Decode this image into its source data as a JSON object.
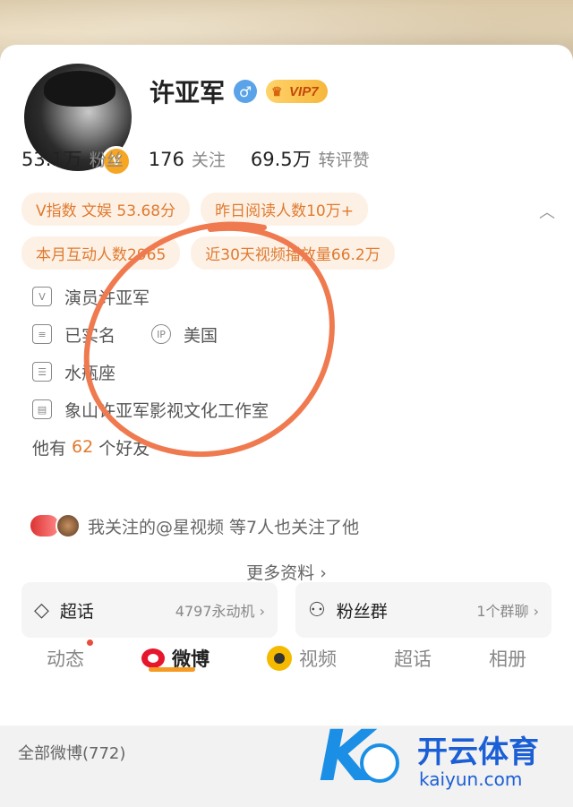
{
  "profile": {
    "name": "许亚军",
    "gender_symbol": "♂",
    "vip_label": "VIP7",
    "verified_badge": "V"
  },
  "stats": [
    {
      "value": "53.1万",
      "label": "粉丝"
    },
    {
      "value": "176",
      "label": "关注"
    },
    {
      "value": "69.5万",
      "label": "转评赞"
    }
  ],
  "tags": {
    "row1": [
      "V指数 文娱 53.68分",
      "昨日阅读人数10万+"
    ],
    "row2": [
      "本月互动人数2965",
      "近30天视频播放量66.2万"
    ]
  },
  "info": {
    "occupation": "演员许亚军",
    "realname": "已实名",
    "ip_label": "美国",
    "zodiac": "水瓶座",
    "company": "象山许亚军影视文化工作室",
    "friends_prefix": "他有",
    "friends_count": "62",
    "friends_suffix": "个好友"
  },
  "mutual_text": "我关注的@星视频 等7人也关注了他",
  "more_info_label": "更多资料 ›",
  "cards": {
    "supertopic": {
      "title": "超话",
      "meta": "4797永动机 ›"
    },
    "fangroup": {
      "title": "粉丝群",
      "meta": "1个群聊 ›"
    }
  },
  "tabs": [
    "动态",
    "微博",
    "视频",
    "超话",
    "相册"
  ],
  "all_weibo_label": "全部微博(772)",
  "watermark": {
    "title": "开云体育",
    "url": "kaiyun.com",
    "letter": "K"
  },
  "colors": {
    "accent": "#f59a23",
    "tag_text": "#e07a2f",
    "tag_bg": "#fdf1e6",
    "annotation": "#f07a4f"
  }
}
